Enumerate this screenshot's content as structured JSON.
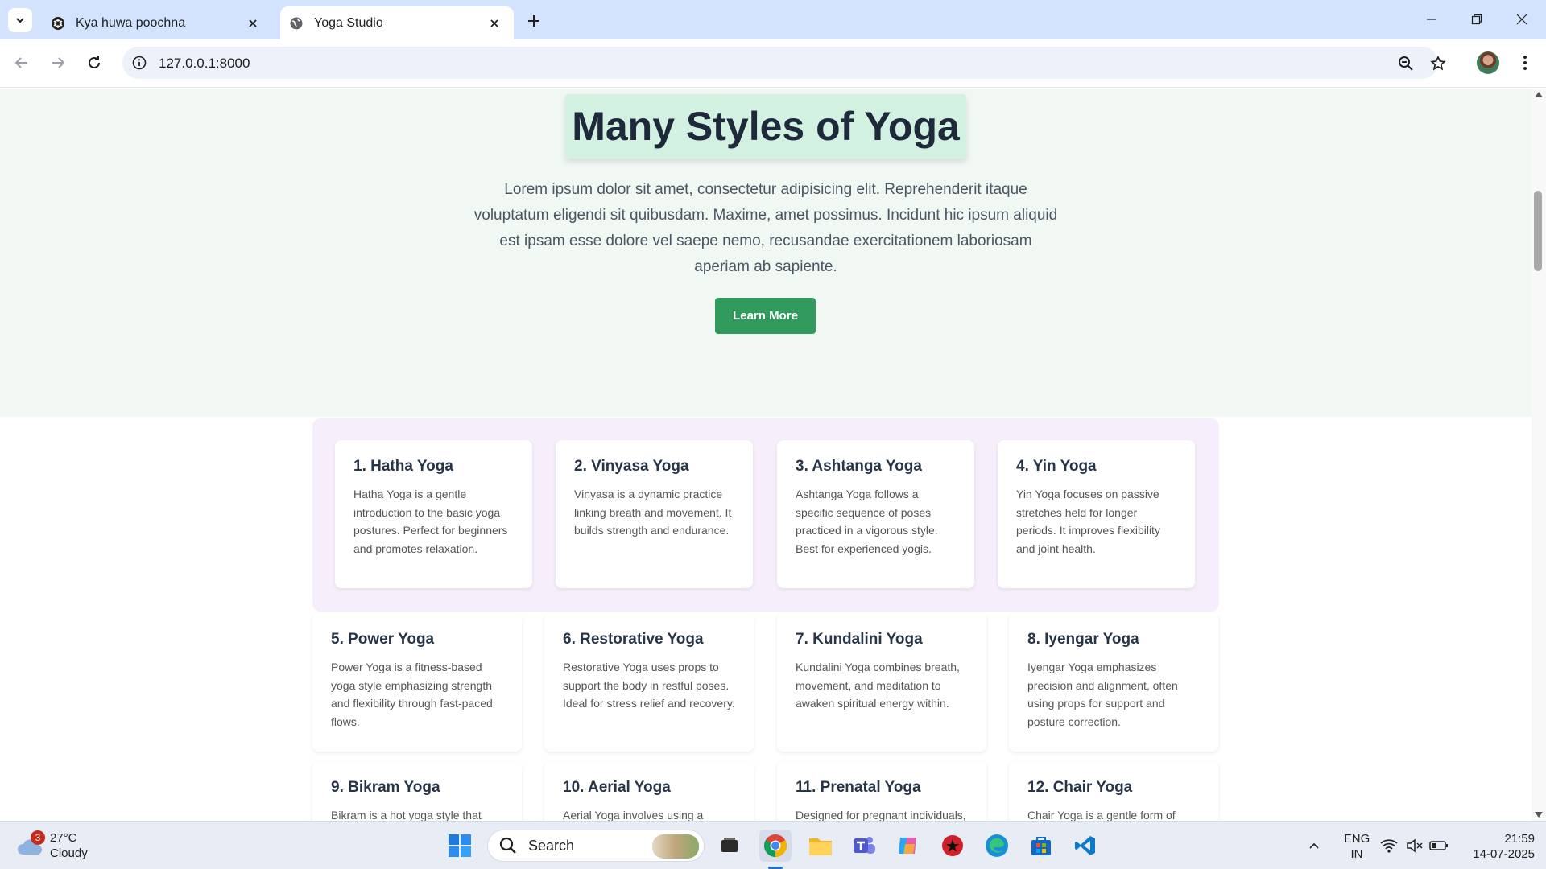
{
  "browser": {
    "tabs": [
      {
        "title": "Kya huwa poochna",
        "active": false
      },
      {
        "title": "Yoga Studio",
        "active": true
      }
    ],
    "url": "127.0.0.1:8000"
  },
  "hero": {
    "title": "Many Styles of Yoga",
    "description": "Lorem ipsum dolor sit amet, consectetur adipisicing elit. Reprehenderit itaque voluptatum eligendi sit quibusdam. Maxime, amet possimus. Incidunt hic ipsum aliquid est ipsam esse dolore vel saepe nemo, recusandae exercitationem laboriosam aperiam ab sapiente.",
    "button_label": "Learn More"
  },
  "cards": [
    {
      "title": "1. Hatha Yoga",
      "text": "Hatha Yoga is a gentle introduction to the basic yoga postures. Perfect for beginners and promotes relaxation."
    },
    {
      "title": "2. Vinyasa Yoga",
      "text": "Vinyasa is a dynamic practice linking breath and movement. It builds strength and endurance."
    },
    {
      "title": "3. Ashtanga Yoga",
      "text": "Ashtanga Yoga follows a specific sequence of poses practiced in a vigorous style. Best for experienced yogis."
    },
    {
      "title": "4. Yin Yoga",
      "text": "Yin Yoga focuses on passive stretches held for longer periods. It improves flexibility and joint health."
    },
    {
      "title": "5. Power Yoga",
      "text": "Power Yoga is a fitness-based yoga style emphasizing strength and flexibility through fast-paced flows."
    },
    {
      "title": "6. Restorative Yoga",
      "text": "Restorative Yoga uses props to support the body in restful poses. Ideal for stress relief and recovery."
    },
    {
      "title": "7. Kundalini Yoga",
      "text": "Kundalini Yoga combines breath, movement, and meditation to awaken spiritual energy within."
    },
    {
      "title": "8. Iyengar Yoga",
      "text": "Iyengar Yoga emphasizes precision and alignment, often using props for support and posture correction."
    },
    {
      "title": "9. Bikram Yoga",
      "text": "Bikram is a hot yoga style that"
    },
    {
      "title": "10. Aerial Yoga",
      "text": "Aerial Yoga involves using a"
    },
    {
      "title": "11. Prenatal Yoga",
      "text": "Designed for pregnant individuals,"
    },
    {
      "title": "12. Chair Yoga",
      "text": "Chair Yoga is a gentle form of"
    }
  ],
  "taskbar": {
    "weather": {
      "temp": "27°C",
      "condition": "Cloudy",
      "badge": "3"
    },
    "search_label": "Search",
    "language": {
      "line1": "ENG",
      "line2": "IN"
    },
    "clock": {
      "time": "21:59",
      "date": "14-07-2025"
    }
  },
  "colors": {
    "accent_green": "#2f9a5b",
    "hero_bg": "#f1f8f4",
    "title_highlight": "#d3f1e0",
    "card_row_highlight": "#f7eefb",
    "tabstrip": "#d3e3fd"
  }
}
